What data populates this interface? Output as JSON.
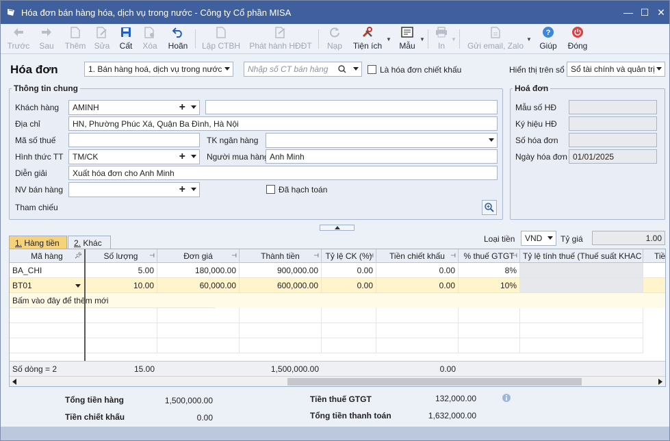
{
  "window": {
    "title": "Hóa đơn bán hàng hóa, dịch vụ trong nước - Công ty Cổ phần MISA",
    "controls": [
      "—",
      "☐",
      "✕"
    ]
  },
  "toolbar": {
    "back": "Trước",
    "next": "Sau",
    "add": "Thêm",
    "edit": "Sửa",
    "save": "Cất",
    "delete": "Xóa",
    "undo": "Hoãn",
    "create_voucher": "Lập CTBH",
    "issue_einvoice": "Phát hành HĐĐT",
    "reload": "Nạp",
    "utilities": "Tiện ích",
    "template": "Mẫu",
    "print": "In",
    "send_email": "Gửi email, Zalo",
    "help": "Giúp",
    "close": "Đóng"
  },
  "header": {
    "title": "Hóa đơn",
    "invoice_type": "1. Bán hàng hoá, dịch vụ trong nước",
    "voucher_placeholder": "Nhập số CT bán hàng",
    "discount_invoice_label": "Là hóa đơn chiết khấu",
    "display_label": "Hiển thị trên sổ",
    "display_value": "Sổ tài chính và quản trị"
  },
  "general": {
    "title": "Thông tin chung",
    "customer_label": "Khách hàng",
    "customer_code": "AMINH",
    "customer_name": "",
    "address_label": "Địa chỉ",
    "address": "HN, Phường Phúc Xá, Quận Ba Đình, Hà Nội",
    "tax_code_label": "Mã số thuế",
    "tax_code": "",
    "bank_account_label": "TK ngân hàng",
    "bank_account": "",
    "payment_label": "Hình thức TT",
    "payment": "TM/CK",
    "buyer_label": "Người mua hàng",
    "buyer": "Anh Minh",
    "description_label": "Diễn giải",
    "description": "Xuất hóa đơn cho Anh Minh",
    "salesperson_label": "NV bán hàng",
    "salesperson": "",
    "posted_label": "Đã hạch toán",
    "reference_label": "Tham chiếu"
  },
  "invoice": {
    "title": "Hoá đơn",
    "form_label": "Mẫu số HĐ",
    "form": "",
    "symbol_label": "Ký hiệu HĐ",
    "symbol": "",
    "number_label": "Số hóa đơn",
    "number": "",
    "date_label": "Ngày hóa đơn",
    "date": "01/01/2025"
  },
  "tabs": [
    {
      "num": "1.",
      "label": "Hàng tiền"
    },
    {
      "num": "2.",
      "label": "Khác"
    }
  ],
  "currency": {
    "label": "Loại tiền",
    "value": "VND",
    "rate_label": "Tỷ giá",
    "rate": "1.00"
  },
  "grid": {
    "columns": [
      "Mã hàng",
      "Số lượng",
      "Đơn giá",
      "Thành tiền",
      "Tỷ lệ CK (%)",
      "Tiền chiết khấu",
      "% thuế GTGT",
      "Tỷ lệ tính thuế (Thuế suất KHAC",
      "Tiề"
    ],
    "rows": [
      {
        "code": "BA_CHI",
        "qty": "5.00",
        "price": "180,000.00",
        "amount": "900,000.00",
        "ck": "0.00",
        "ck_amount": "0.00",
        "vat": "8%",
        "rate": "",
        "tax": ""
      },
      {
        "code": "BT01",
        "qty": "10.00",
        "price": "60,000.00",
        "amount": "600,000.00",
        "ck": "0.00",
        "ck_amount": "0.00",
        "vat": "10%",
        "rate": "",
        "tax": ""
      }
    ],
    "add_hint": "Bấm vào đây để thêm mới",
    "footer": {
      "count": "Số dòng = 2",
      "qty": "15.00",
      "amount": "1,500,000.00",
      "ck_amount": "0.00"
    }
  },
  "totals": {
    "goods_label": "Tổng tiền hàng",
    "goods": "1,500,000.00",
    "discount_label": "Tiền chiết khấu",
    "discount": "0.00",
    "vat_label": "Tiền thuế GTGT",
    "vat": "132,000.00",
    "payment_label": "Tổng tiền thanh toán",
    "payment": "1,632,000.00"
  }
}
